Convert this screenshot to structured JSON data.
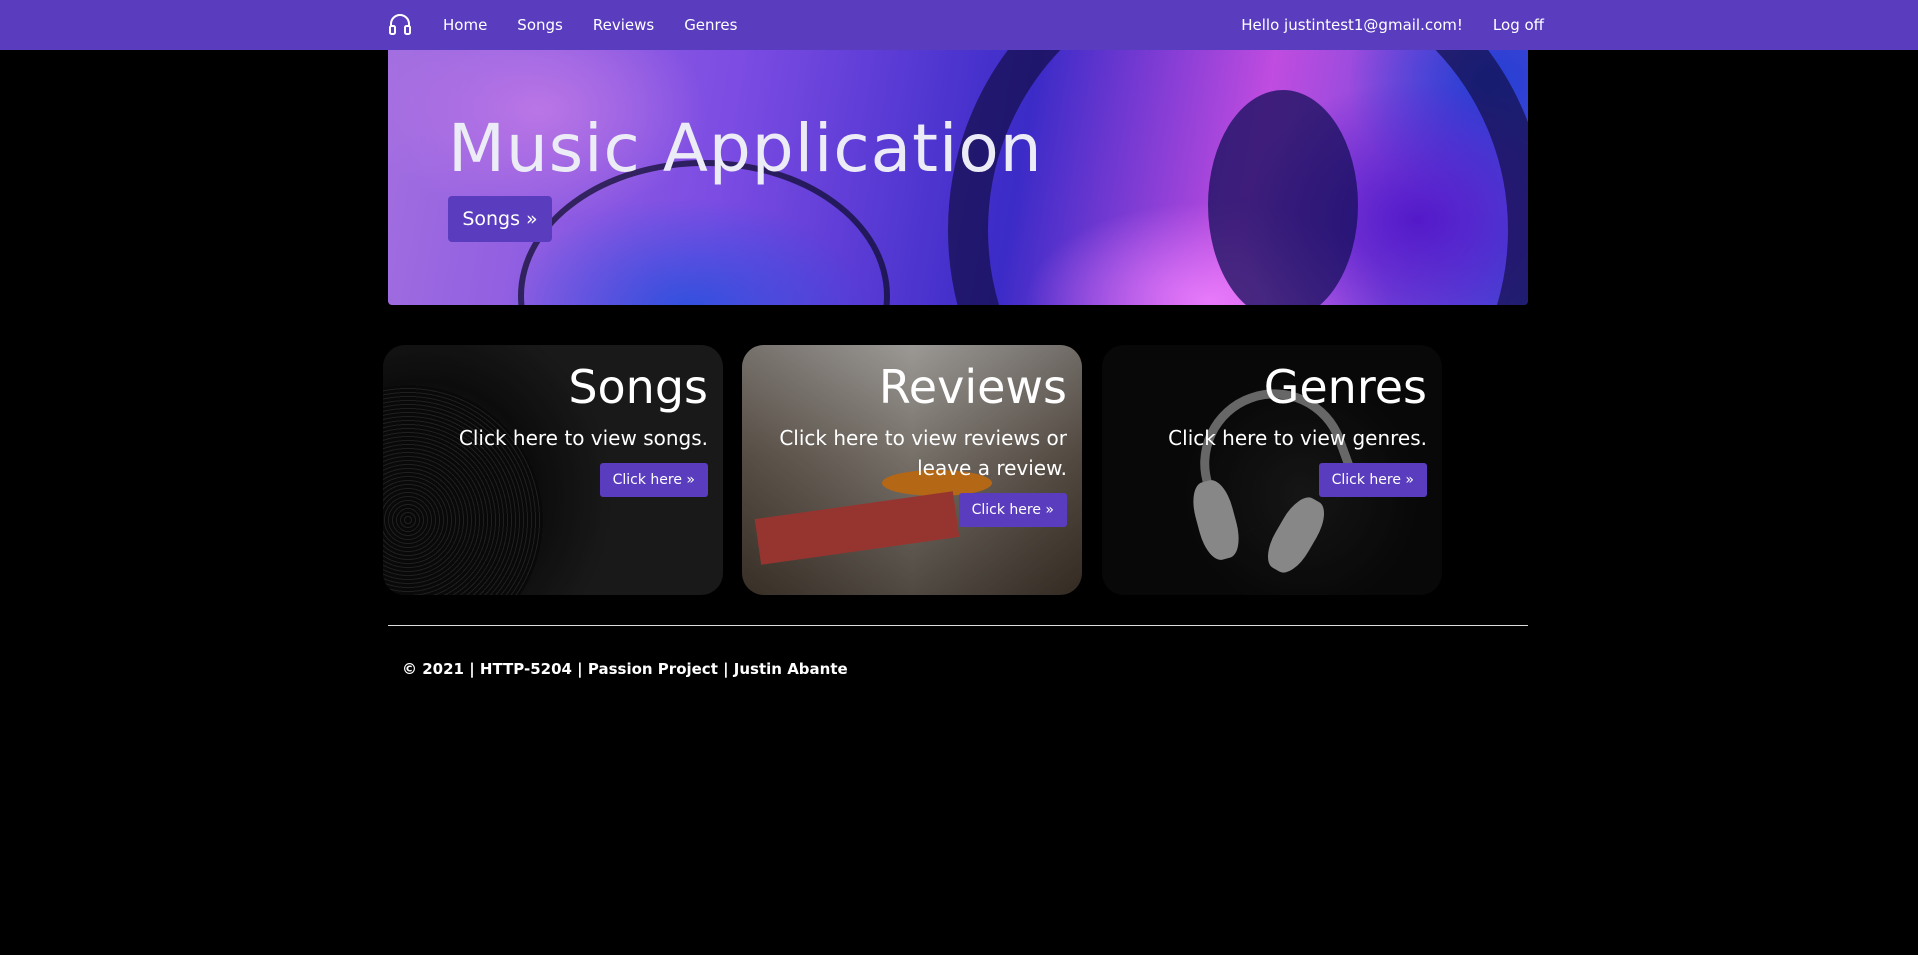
{
  "navbar": {
    "brand_icon": "headphones-icon",
    "links": [
      "Home",
      "Songs",
      "Reviews",
      "Genres"
    ],
    "greeting": "Hello justintest1@gmail.com!",
    "logoff": "Log off"
  },
  "hero": {
    "title": "Music Application",
    "button": "Songs »"
  },
  "cards": [
    {
      "title": "Songs",
      "text": "Click here to view songs.",
      "button": "Click here »"
    },
    {
      "title": "Reviews",
      "text": "Click here to view reviews or leave a review.",
      "button": "Click here »"
    },
    {
      "title": "Genres",
      "text": "Click here to view genres.",
      "button": "Click here »"
    }
  ],
  "footer": {
    "text": "© 2021 | HTTP-5204 | Passion Project | Justin Abante"
  },
  "colors": {
    "accent": "#5a3cbf",
    "background": "#000000"
  }
}
